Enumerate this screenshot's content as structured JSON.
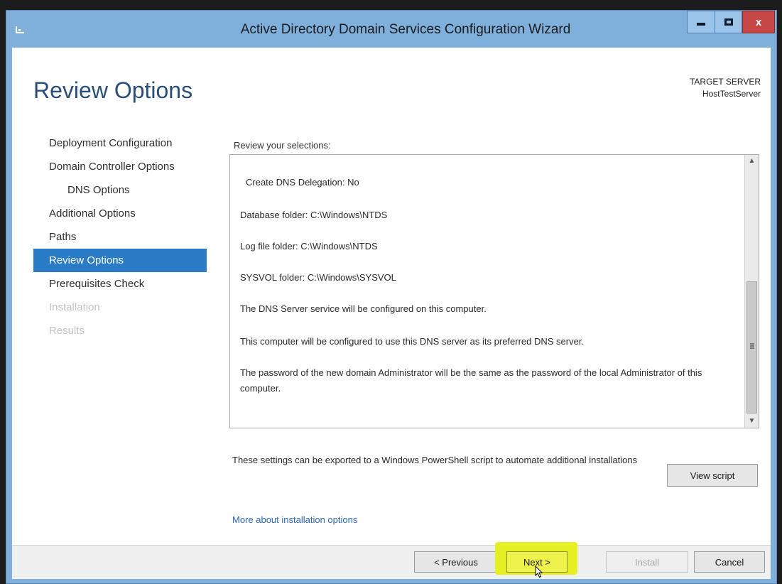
{
  "window": {
    "title": "Active Directory Domain Services Configuration Wizard",
    "controls": {
      "minimize": "minimize-icon",
      "maximize": "maximize-icon",
      "close": "close-icon"
    }
  },
  "header": {
    "page_title": "Review Options",
    "target_label": "TARGET SERVER",
    "target_value": "HostTestServer"
  },
  "nav": {
    "items": [
      {
        "label": "Deployment Configuration",
        "state": "normal"
      },
      {
        "label": "Domain Controller Options",
        "state": "normal"
      },
      {
        "label": "DNS Options",
        "state": "sub"
      },
      {
        "label": "Additional Options",
        "state": "normal"
      },
      {
        "label": "Paths",
        "state": "normal"
      },
      {
        "label": "Review Options",
        "state": "active"
      },
      {
        "label": "Prerequisites Check",
        "state": "normal"
      },
      {
        "label": "Installation",
        "state": "disabled"
      },
      {
        "label": "Results",
        "state": "disabled"
      }
    ]
  },
  "review": {
    "label": "Review your selections:",
    "lines": [
      "Create DNS Delegation: No",
      "Database folder: C:\\Windows\\NTDS",
      "Log file folder: C:\\Windows\\NTDS",
      "SYSVOL folder: C:\\Windows\\SYSVOL",
      "The DNS Server service will be configured on this computer.",
      "This computer will be configured to use this DNS server as its preferred DNS server.",
      "The password of the new domain Administrator will be the same as the password of the local Administrator of this computer."
    ]
  },
  "export": {
    "text": "These settings can be exported to a Windows PowerShell script to automate additional installations",
    "view_script_label": "View script"
  },
  "more_link": "More about installation options",
  "footer": {
    "previous_label": "< Previous",
    "next_label": "Next >",
    "install_label": "Install",
    "cancel_label": "Cancel"
  },
  "colors": {
    "titlebar": "#7fb0dc",
    "accent": "#2a7cc7",
    "title_text": "#2a4e7a",
    "link": "#2b66b5",
    "highlight": "#e6ef22",
    "close_button": "#c74646"
  }
}
